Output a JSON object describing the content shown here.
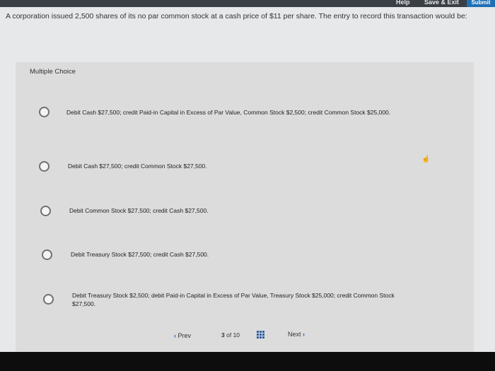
{
  "header": {
    "help": "Help",
    "save_exit": "Save & Exit",
    "submit": "Submit"
  },
  "question": {
    "text": "A corporation issued 2,500 shares of its no par common stock at a cash price of $11 per share. The entry to record this transaction would be:"
  },
  "multiple_choice_label": "Multiple Choice",
  "options": [
    "Debit Cash $27,500; credit Paid-in Capital in Excess of Par Value, Common Stock $2,500; credit Common Stock $25,000.",
    "Debit Cash $27,500; credit Common Stock $27,500.",
    "Debit Common Stock $27,500; credit Cash $27,500.",
    "Debit Treasury Stock $27,500; credit Cash $27,500.",
    "Debit Treasury Stock $2,500; debit Paid-in Capital in Excess of Par Value, Treasury Stock $25,000; credit Common Stock $27,500."
  ],
  "navigation": {
    "prev_label": "Prev",
    "next_label": "Next",
    "current": "3",
    "of_label": "of",
    "total": "10"
  },
  "icons": {
    "prev": "chevron-left-icon",
    "next": "chevron-right-icon",
    "grid": "grid-icon",
    "cursor": "hand-cursor-icon"
  },
  "colors": {
    "accent": "#1b5fa6",
    "submit_bg": "#1f6fb5"
  }
}
